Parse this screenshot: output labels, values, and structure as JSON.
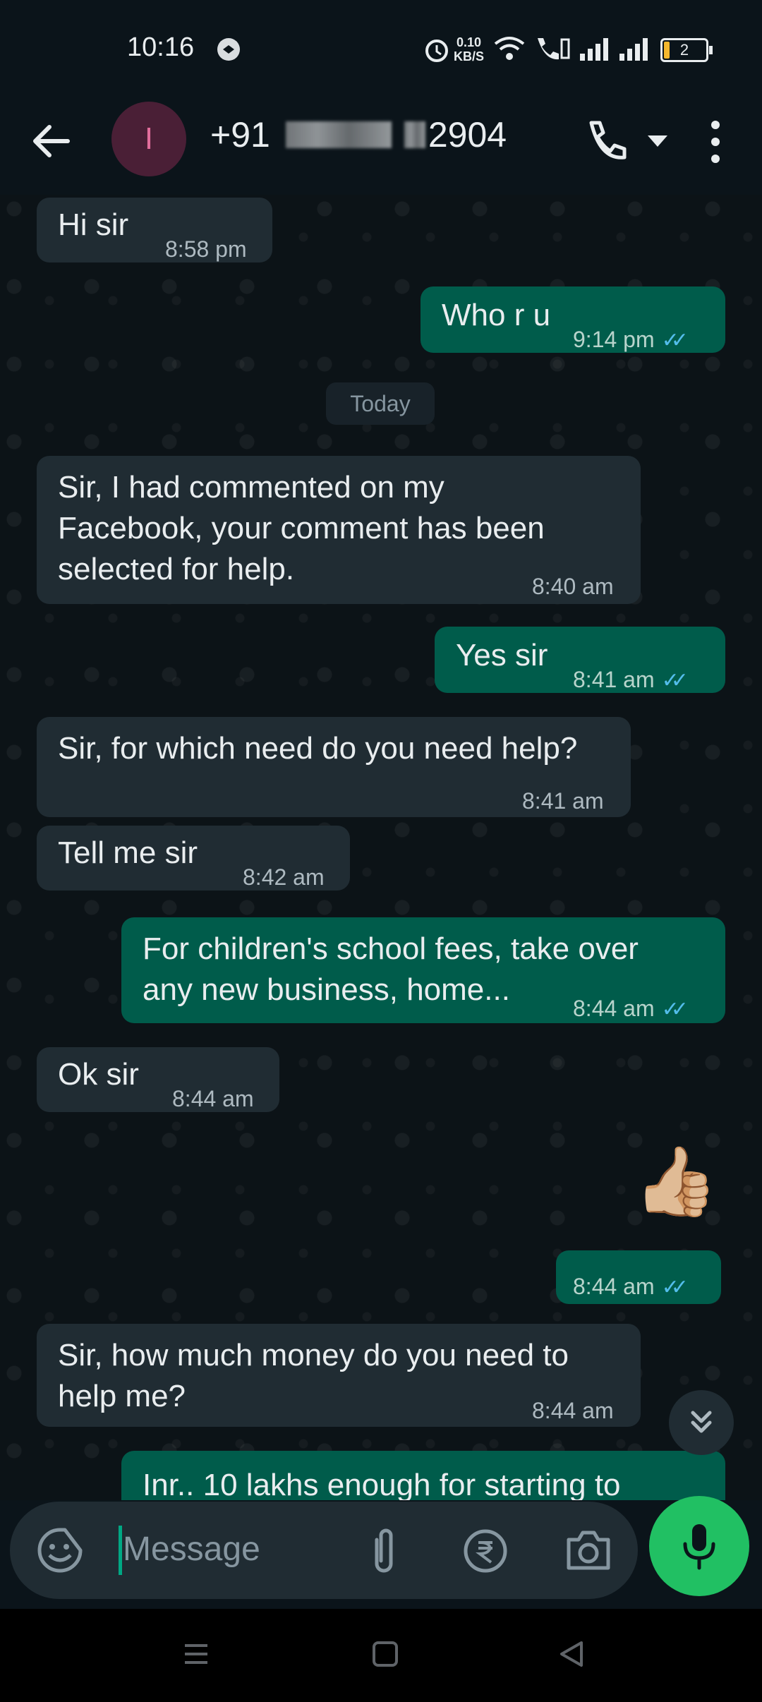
{
  "status_bar": {
    "time": "10:16",
    "net_speed_value": "0.10",
    "net_speed_unit": "KB/S",
    "battery": "2"
  },
  "header": {
    "avatar_letter": "I",
    "contact_prefix": "+91",
    "contact_suffix": "2904",
    "icons": [
      "back-arrow-icon",
      "phone-icon",
      "dropdown-icon",
      "more-options-icon"
    ]
  },
  "messages": [
    {
      "dir": "in",
      "text": "Hi sir",
      "time": "8:58 pm"
    },
    {
      "dir": "out",
      "text": "Who r u",
      "time": "9:14 pm",
      "ticks": "✓✓"
    },
    {
      "dir": "divider",
      "text": "Today"
    },
    {
      "dir": "in",
      "text": "Sir, I had commented on my\nFacebook, your comment has been\nselected for help.",
      "time": "8:40 am"
    },
    {
      "dir": "out",
      "text": "Yes sir",
      "time": "8:41 am",
      "ticks": "✓✓"
    },
    {
      "dir": "in",
      "text": "Sir, for which need do you need help?",
      "time": "8:41 am"
    },
    {
      "dir": "in",
      "text": "Tell me sir",
      "time": "8:42 am"
    },
    {
      "dir": "out",
      "text": "For children's school fees, take over\nany new business, home...",
      "time": "8:44 am",
      "ticks": "✓✓"
    },
    {
      "dir": "in",
      "text": "Ok sir",
      "time": "8:44 am"
    },
    {
      "dir": "out",
      "text": "👍🏼",
      "time": "8:44 am",
      "ticks": "✓✓"
    },
    {
      "dir": "in",
      "text": "Sir, how much money do you need to\nhelp me?",
      "time": "8:44 am"
    },
    {
      "dir": "out",
      "text": "Inr.. 10 lakhs enough for starting to"
    }
  ],
  "input": {
    "placeholder": "Message",
    "icons": [
      "emoji-icon",
      "attach-icon",
      "rupee-icon",
      "camera-icon",
      "mic-icon"
    ]
  },
  "colors": {
    "incoming_bubble": "#202c33",
    "outgoing_bubble": "#005c4b",
    "accent": "#21c063",
    "read_ticks": "#53bdeb"
  }
}
